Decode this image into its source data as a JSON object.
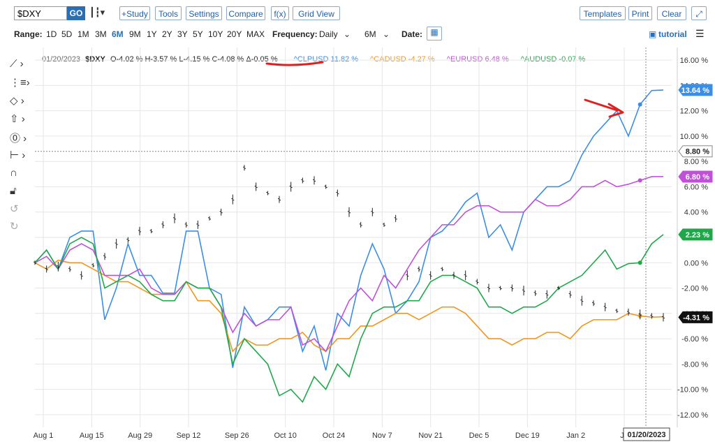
{
  "toolbar": {
    "symbol": "$DXY",
    "go": "GO",
    "chart_type_icon": "candlestick-icon",
    "study": "+Study",
    "tools": "Tools",
    "settings": "Settings",
    "compare": "Compare",
    "fx": "f(x)",
    "grid_view": "Grid View",
    "templates": "Templates",
    "print": "Print",
    "clear": "Clear",
    "expand_icon": "expand-icon"
  },
  "rangebar": {
    "range_label": "Range:",
    "ranges": [
      "1D",
      "5D",
      "1M",
      "3M",
      "6M",
      "9M",
      "1Y",
      "2Y",
      "3Y",
      "5Y",
      "10Y",
      "20Y",
      "MAX"
    ],
    "active_range": "6M",
    "frequency_label": "Frequency:",
    "frequency": "Daily",
    "period": "6M",
    "date_label": "Date:",
    "tutorial": "tutorial"
  },
  "legend": {
    "date": "01/20/2023",
    "symbol": "$DXY",
    "ohlc": "O-4.02 % H-3.57 % L-4.15 % C-4.08 % Δ-0.05 %",
    "series_labels": [
      "^CLPUSD 11.82 %",
      "^CADUSD -4.27 %",
      "^EURUSD 6.48 %",
      "^AUDUSD -0.07 %"
    ]
  },
  "colors": {
    "clp": "#3a8ee6",
    "cad": "#f0961e",
    "eur": "#c050d8",
    "aud": "#1fa84a",
    "dxy": "#222222",
    "accent": "#2a6fb5",
    "annotation": "#e02020"
  },
  "chart_data": {
    "type": "line",
    "x_ticks": [
      "Aug 1",
      "Aug 15",
      "Aug 29",
      "Sep 12",
      "Sep 26",
      "Oct 10",
      "Oct 24",
      "Nov 7",
      "Nov 21",
      "Dec 5",
      "Dec 19",
      "Jan 2",
      "Ja"
    ],
    "crosshair_date": "01/20/2023",
    "y_ticks": [
      "16.00 %",
      "14.00 %",
      "12.00 %",
      "10.00 %",
      "8.00 %",
      "6.00 %",
      "4.00 %",
      "2.00 %",
      "0.00 %",
      "-2.00 %",
      "-4.00 %",
      "-6.00 %",
      "-8.00 %",
      "-10.00 %",
      "-12.00 %"
    ],
    "ylim": [
      -13,
      17
    ],
    "last_value_labels": [
      "13.64 %",
      "8.80 %",
      "6.80 %",
      "2.23 %",
      "-4.31 %"
    ],
    "grid": true,
    "series": [
      {
        "name": "^CLPUSD",
        "values": [
          0,
          1,
          -0.5,
          2,
          2.5,
          2.5,
          -4.5,
          -2,
          1.5,
          -1,
          -1,
          -2.4,
          -2.4,
          2.5,
          2.5,
          -2,
          -2.5,
          -8.3,
          -3.5,
          -5,
          -4.5,
          -3.5,
          -3.5,
          -7,
          -5,
          -8.5,
          -4,
          -5,
          -1,
          1.5,
          -0.5,
          -4,
          -3,
          -1.5,
          2,
          2.5,
          3.5,
          4.8,
          5.5,
          2,
          3,
          1,
          4,
          5,
          6,
          6,
          6.5,
          8.5,
          10,
          11,
          12,
          10,
          12.5,
          13.6,
          13.64
        ]
      },
      {
        "name": "^CADUSD",
        "values": [
          0,
          -0.5,
          0.2,
          0,
          0,
          -0.5,
          -1,
          -1.5,
          -1.5,
          -2,
          -2.5,
          -2.5,
          -2.5,
          -1.5,
          -3,
          -3,
          -4,
          -7,
          -6,
          -6.5,
          -6.5,
          -6,
          -6,
          -5.5,
          -6.5,
          -7,
          -6,
          -6,
          -5,
          -5,
          -4.5,
          -4,
          -4,
          -4.5,
          -4,
          -3.5,
          -3.5,
          -4,
          -5,
          -6,
          -6,
          -6.5,
          -6,
          -6,
          -5.5,
          -5.5,
          -6,
          -5,
          -4.5,
          -4.5,
          -4.5,
          -4,
          -4.2,
          -4.3,
          -4.27
        ]
      },
      {
        "name": "^EURUSD",
        "values": [
          0,
          0.5,
          -0.5,
          1,
          1.5,
          1,
          -1,
          -1,
          -1,
          -0.5,
          -2,
          -2.5,
          -2.5,
          -1.5,
          -2,
          -2,
          -3.5,
          -5.5,
          -4,
          -5,
          -4.5,
          -4.5,
          -3.5,
          -6.5,
          -6,
          -7,
          -5,
          -3,
          -2,
          -3,
          -1,
          -2,
          -0.5,
          1,
          2,
          3,
          3,
          4,
          4.5,
          4.5,
          4,
          4,
          4,
          5,
          4.5,
          4.5,
          5,
          6,
          6,
          6.5,
          6,
          6.2,
          6.5,
          6.8,
          6.8
        ]
      },
      {
        "name": "^AUDUSD",
        "values": [
          0,
          1,
          -0.5,
          1.5,
          2,
          1.5,
          -2,
          -1.5,
          -1,
          -1.5,
          -2.5,
          -3,
          -3,
          -1.5,
          -2,
          -2,
          -3.5,
          -8,
          -6,
          -7,
          -8,
          -10.5,
          -10,
          -11,
          -9,
          -10,
          -8,
          -9,
          -6,
          -4,
          -3.5,
          -3.5,
          -3,
          -3,
          -1.5,
          -1,
          -1,
          -1.5,
          -2,
          -3.5,
          -3.5,
          -4,
          -3.5,
          -3.5,
          -3,
          -2,
          -1.5,
          -1,
          0,
          1,
          -0.5,
          -0.07,
          0,
          1.5,
          2.23
        ]
      },
      {
        "name": "$DXY",
        "values": [
          0,
          -0.5,
          -0.3,
          -0.5,
          -1,
          -0.2,
          0.5,
          1.5,
          1.8,
          2.5,
          2.5,
          3,
          3.5,
          3,
          3,
          3.5,
          4,
          5,
          7.5,
          6,
          5.5,
          5,
          6,
          6.5,
          6.5,
          6,
          5.5,
          4,
          3,
          4,
          3,
          3.5,
          -1,
          -0.5,
          -1,
          -0.5,
          -1,
          -1,
          -1.5,
          -2,
          -2,
          -2,
          -2.2,
          -2.4,
          -2.5,
          -2,
          -2.5,
          -3,
          -3.2,
          -3.5,
          -3.8,
          -3.9,
          -4.08,
          -4.2,
          -4.31
        ]
      }
    ]
  }
}
